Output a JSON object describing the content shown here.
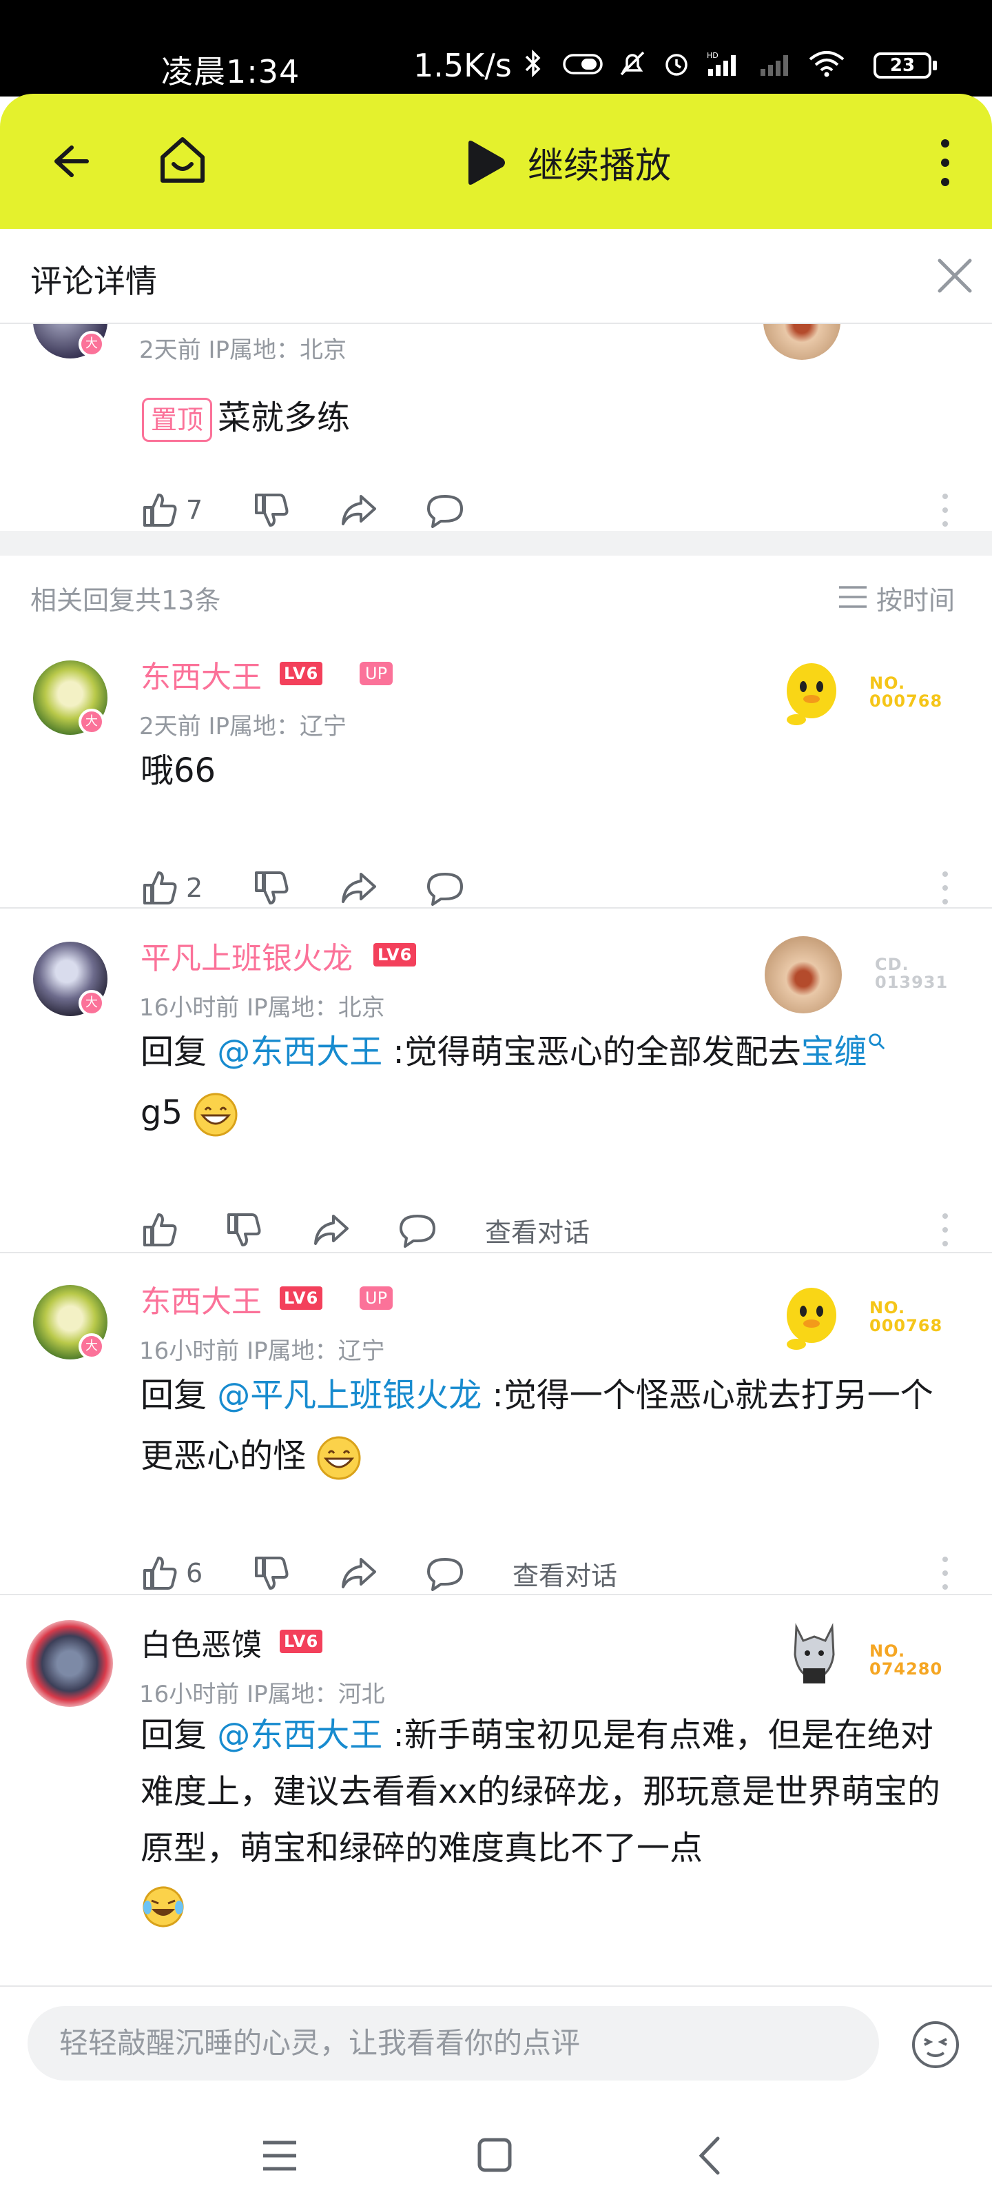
{
  "status_bar": {
    "time": "凌晨1:34",
    "net_speed": "1.5K/s",
    "battery": "23",
    "icons": [
      "bluetooth-icon",
      "toggle-icon",
      "mute-icon",
      "alarm-icon",
      "signal-hd-icon",
      "signal-2-icon",
      "wifi-icon"
    ]
  },
  "top_bar": {
    "play_label": "继续播放",
    "color": "#e4f12d"
  },
  "detail_header": {
    "title": "评论详情"
  },
  "root_comment": {
    "meta": "2天前 IP属地：北京",
    "pin_label": "置顶",
    "text": "菜就多练",
    "like_count": "7"
  },
  "replies_header": {
    "count_label": "相关回复共13条",
    "sort_label": "按时间"
  },
  "replies": [
    {
      "username": "东西大王",
      "level": "LV6",
      "up_badge": "UP",
      "meta": "2天前 IP属地：辽宁",
      "reply_prefix": "",
      "mention": "",
      "text": "哦66",
      "like_count": "2",
      "medal_label": "NO.",
      "medal_number": "000768",
      "view_conversation": ""
    },
    {
      "username": "平凡上班银火龙",
      "level": "LV6",
      "up_badge": "",
      "meta": "16小时前 IP属地：北京",
      "reply_prefix": "回复 ",
      "mention": "@东西大王",
      "text_before_link": " :觉得萌宝恶心的全部发配去",
      "link": "宝缠",
      "text_after_link": "g5",
      "like_count": "",
      "medal_label": "CD.",
      "medal_number": "013931",
      "view_conversation": "查看对话"
    },
    {
      "username": "东西大王",
      "level": "LV6",
      "up_badge": "UP",
      "meta": "16小时前 IP属地：辽宁",
      "reply_prefix": "回复 ",
      "mention": "@平凡上班银火龙",
      "text": " :觉得一个怪恶心就去打另一个更恶心的怪",
      "like_count": "6",
      "medal_label": "NO.",
      "medal_number": "000768",
      "view_conversation": "查看对话"
    },
    {
      "username": "白色恶馍",
      "level": "LV6",
      "up_badge": "",
      "meta": "16小时前 IP属地：河北",
      "reply_prefix": "回复 ",
      "mention": "@东西大王",
      "text": " :新手萌宝初见是有点难，但是在绝对难度上，建议去看看xx的绿碎龙，那玩意是世界萌宝的原型，萌宝和绿碎的难度真比不了一点",
      "like_count": "",
      "medal_label": "NO.",
      "medal_number": "074280",
      "view_conversation": ""
    }
  ],
  "input": {
    "placeholder": "轻轻敲醒沉睡的心灵，让我看看你的点评"
  },
  "colors": {
    "accent_pink": "#fb7299",
    "link_blue": "#178bcf",
    "level_red": "#f3405b",
    "medal_gold": "#f5c518"
  }
}
